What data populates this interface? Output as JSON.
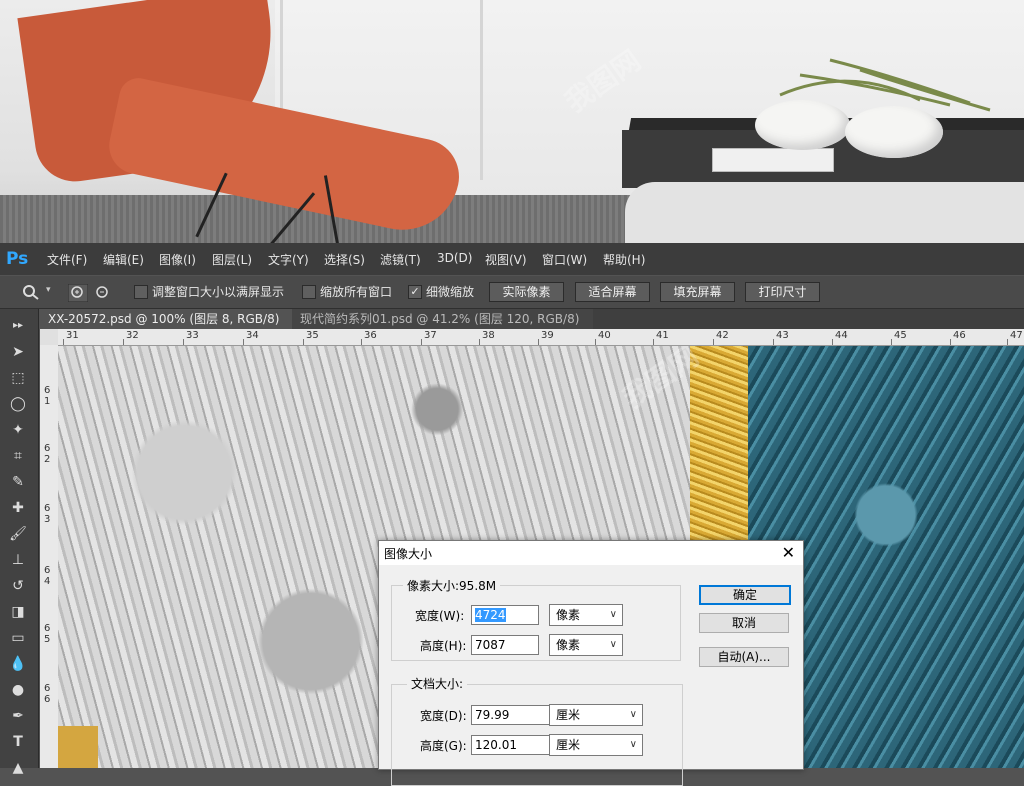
{
  "menubar": {
    "logo": "Ps",
    "items": [
      "文件(F)",
      "编辑(E)",
      "图像(I)",
      "图层(L)",
      "文字(Y)",
      "选择(S)",
      "滤镜(T)",
      "3D(D)",
      "视图(V)",
      "窗口(W)",
      "帮助(H)"
    ]
  },
  "options": {
    "resize_windows": "调整窗口大小以满屏显示",
    "zoom_all": "缩放所有窗口",
    "scrubby_zoom": "细微缩放",
    "btn_actual": "实际像素",
    "btn_fit": "适合屏幕",
    "btn_fill": "填充屏幕",
    "btn_print": "打印尺寸"
  },
  "tabs": [
    "XX-20572.psd @ 100% (图层 8, RGB/8) *",
    "现代简约系列01.psd @ 41.2% (图层 120, RGB/8) *"
  ],
  "ruler": {
    "h": [
      "31",
      "32",
      "33",
      "34",
      "35",
      "36",
      "37",
      "38",
      "39",
      "40",
      "41",
      "42",
      "43",
      "44",
      "45",
      "46",
      "47"
    ],
    "v": [
      "6\n1",
      "6\n2",
      "6\n3",
      "6\n4",
      "6\n5",
      "6\n6"
    ]
  },
  "dialog": {
    "title": "图像大小",
    "close": "✕",
    "pixel_group": "像素大小:95.8M",
    "width_label": "宽度(W):",
    "width_value": "4724",
    "height_label": "高度(H):",
    "height_value": "7087",
    "pixel_unit": "像素",
    "doc_group": "文档大小:",
    "doc_width_label": "宽度(D):",
    "doc_width_value": "79.99",
    "doc_height_label": "高度(G):",
    "doc_height_value": "120.01",
    "doc_unit": "厘米",
    "ok": "确定",
    "cancel": "取消",
    "auto": "自动(A)..."
  }
}
